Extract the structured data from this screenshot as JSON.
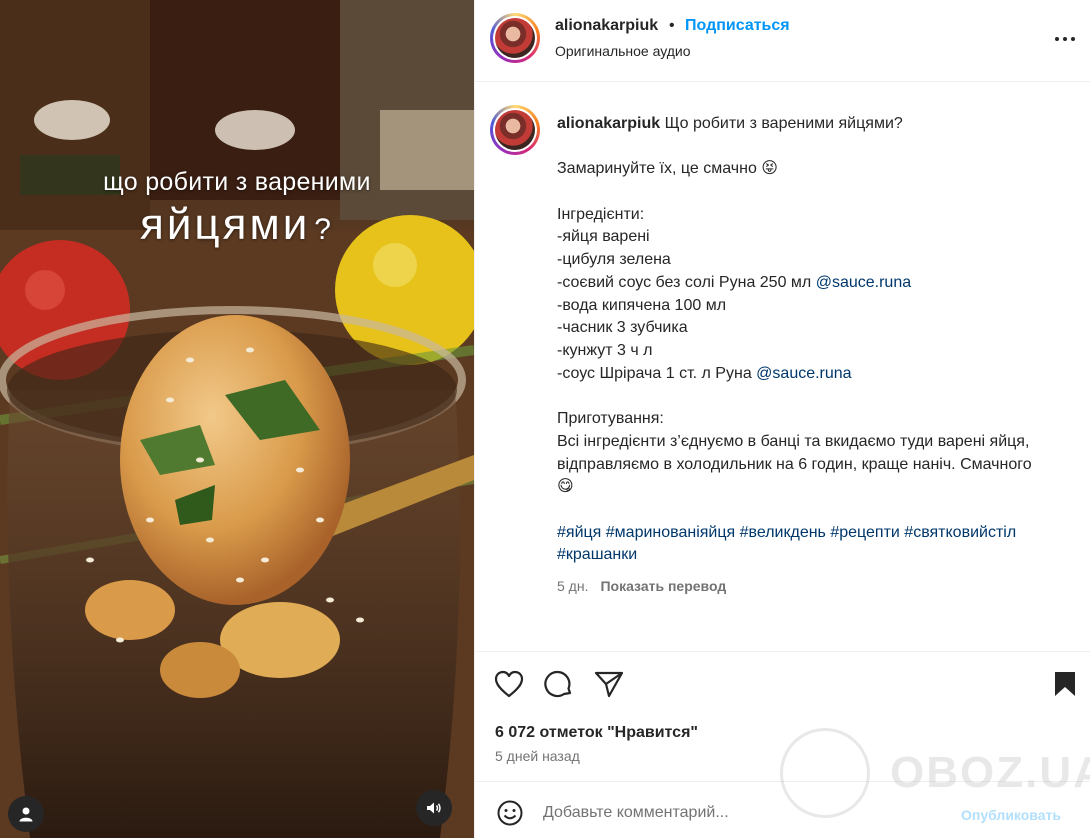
{
  "media": {
    "title_line1": "що робити з вареними",
    "title_line2": "яйцями",
    "title_mark": "?"
  },
  "header": {
    "username": "alionakarpiuk",
    "separator": "•",
    "follow_label": "Подписаться",
    "audio_label": "Оригинальное аудио",
    "more_icon": "more-horizontal-icon"
  },
  "caption": {
    "username": "alionakarpiuk",
    "lines": [
      "Що робити з вареними яйцями?",
      "",
      "Замаринуйте їх, це смачно 😝",
      "",
      "Інгредієнти:",
      "-яйця варені",
      "-цибуля зелена",
      "-соєвий соус без солі Руна 250 мл",
      "-вода кипячена 100 мл",
      "-часник 3 зубчика",
      "-кунжут 3 ч л",
      "-соус Шрірача 1 ст. л Руна",
      "",
      "Приготування:",
      "Всі інгредієнти з’єднуємо в банці та вкидаємо туди варені яйця,",
      "відправляємо в холодильник на 6 годин, краще наніч. Смачного",
      "😋",
      ""
    ],
    "mention": "@sauce.runa",
    "hashtags_line1": "#яйця #маринованіяйця #великдень #рецепти #святковийстіл",
    "hashtags_line2": "#крашанки",
    "time": "5 дн.",
    "translate_label": "Показать перевод"
  },
  "actions": {
    "likes": "6 072 отметок \"Нравится\"",
    "time_ago": "5 дней назад"
  },
  "comment": {
    "placeholder": "Добавьте комментарий...",
    "post_label": "Опубликовать"
  },
  "watermark": {
    "text": "OBOZ.UA"
  },
  "colors": {
    "link_blue": "#0095f6",
    "mention_blue": "#00376b",
    "muted": "#737373"
  }
}
